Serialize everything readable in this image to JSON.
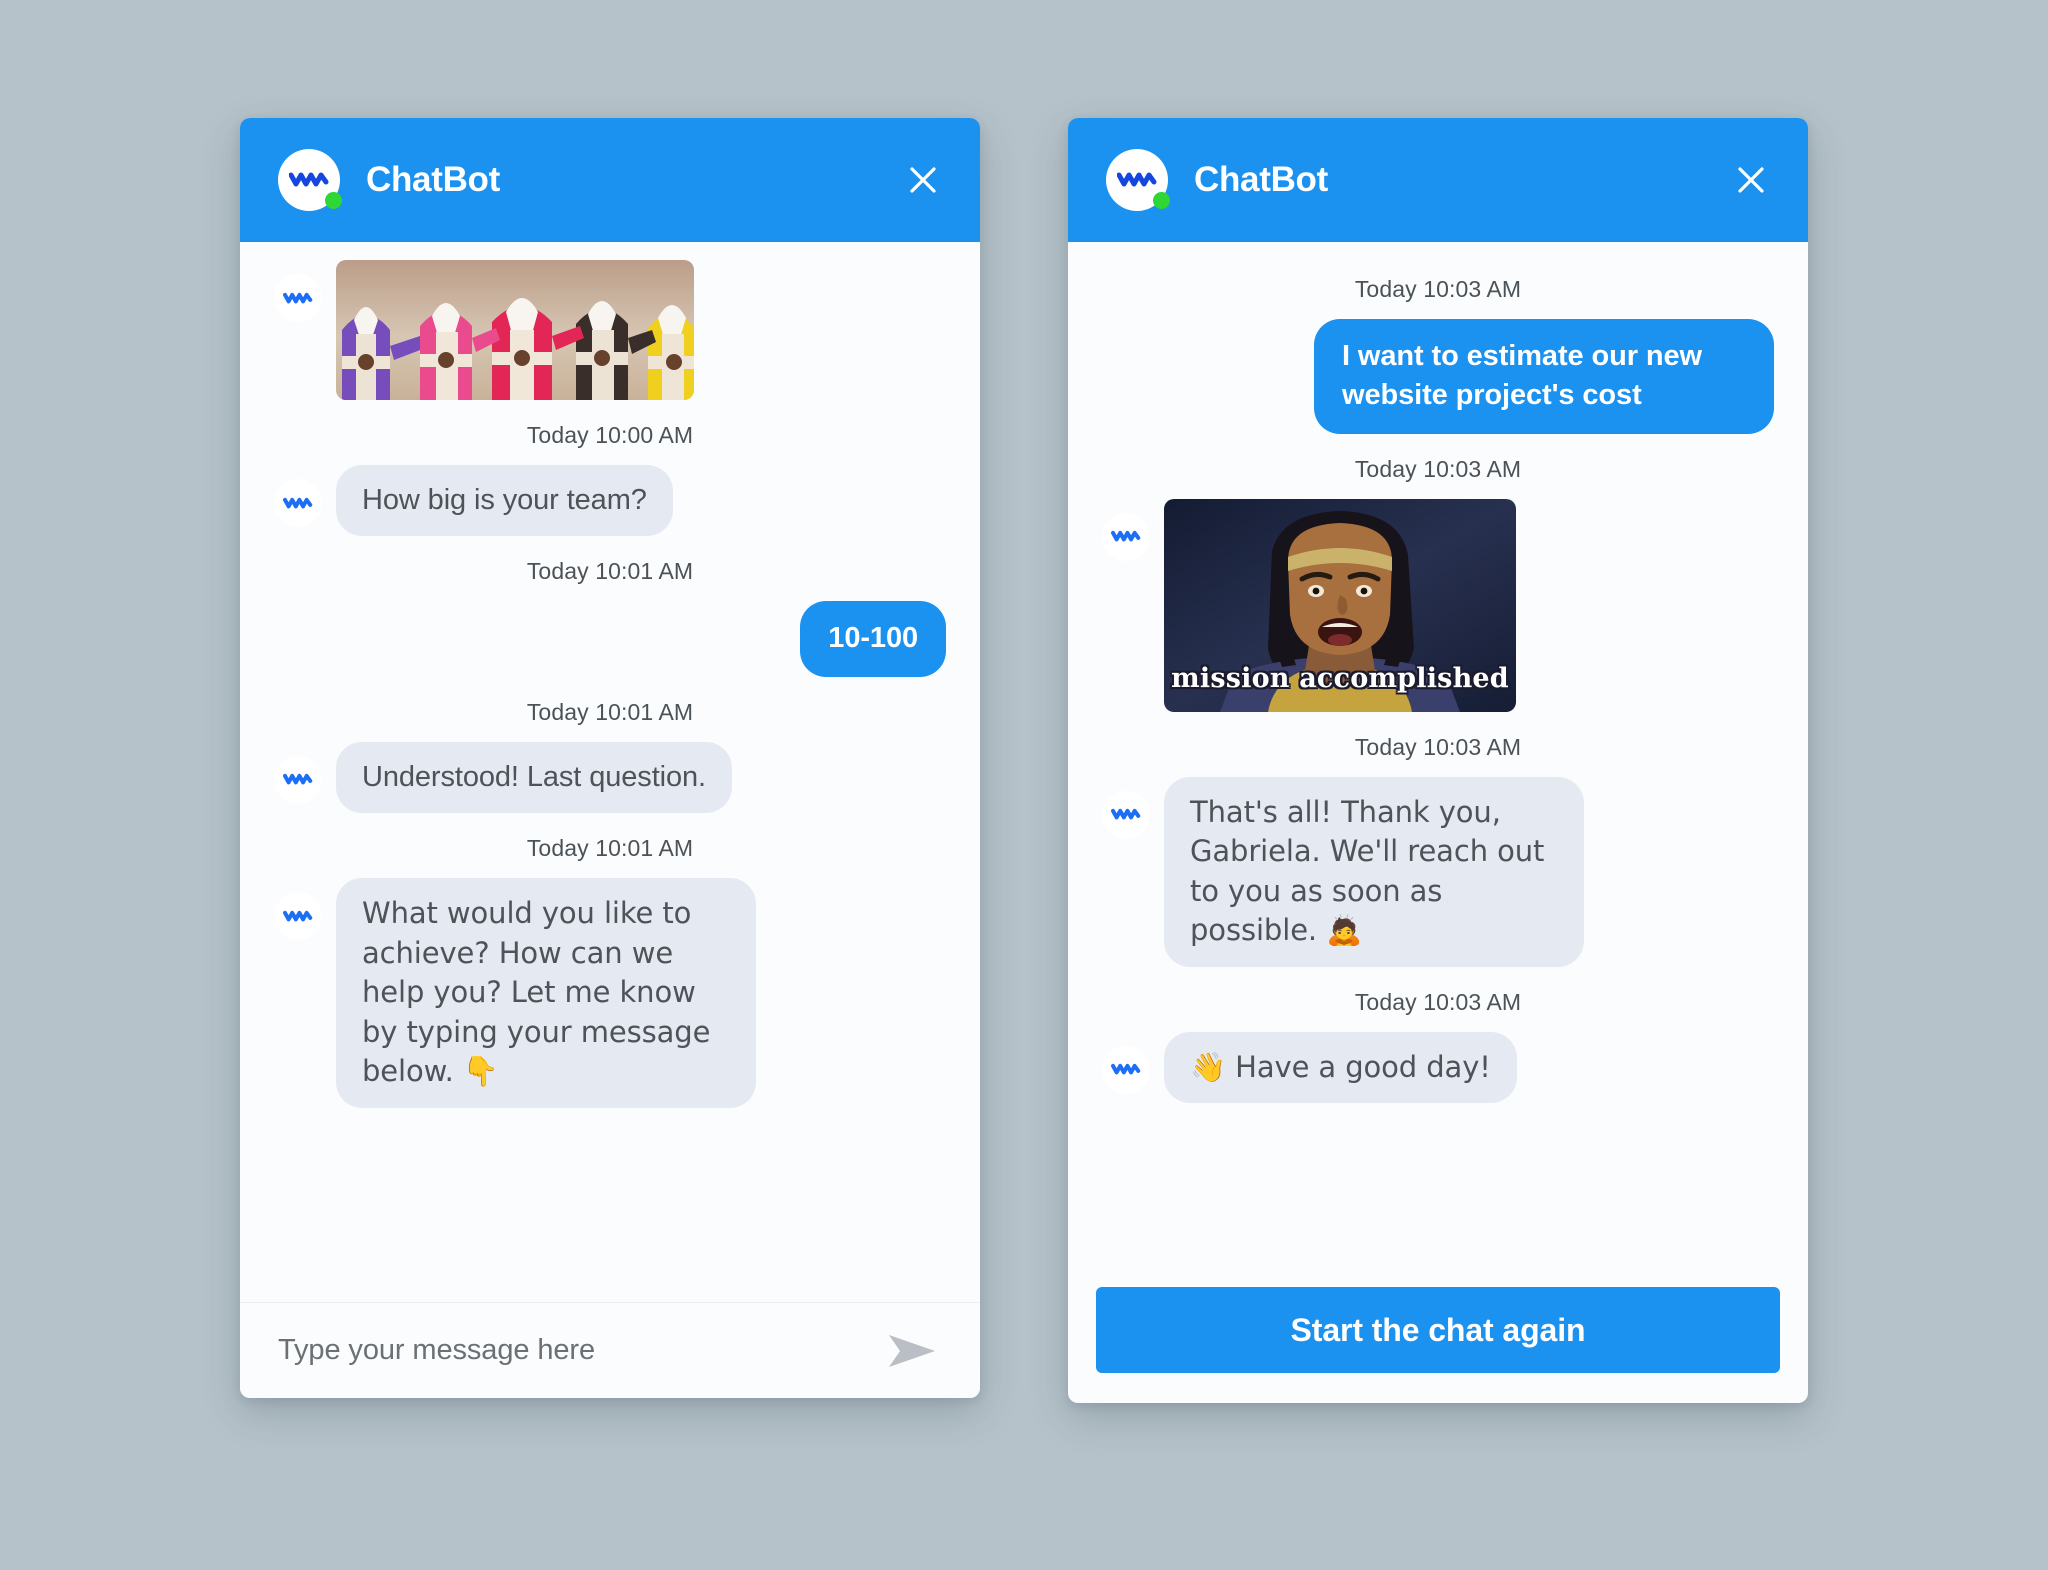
{
  "brand": {
    "accent_color": "#1b91f0",
    "bot_bubble_color": "#e5e9f2",
    "bot_text_color": "#4d5458",
    "status_color": "#2ed636",
    "page_background": "#b5c2c9",
    "panel_background": "#fbfcfd"
  },
  "left_panel": {
    "header": {
      "title": "ChatBot",
      "close_label": "×",
      "status": "online"
    },
    "messages": [
      {
        "from": "bot",
        "type": "image",
        "alt": "Power Rangers team fist bump",
        "caption": ""
      },
      {
        "from": "bot",
        "type": "text",
        "timestamp": "Today 10:00 AM",
        "text": "How big is your team?"
      },
      {
        "from": "user",
        "type": "text",
        "timestamp": "Today 10:01 AM",
        "text": "10-100"
      },
      {
        "from": "bot",
        "type": "text",
        "timestamp": "Today 10:01 AM",
        "text": "Understood! Last question."
      },
      {
        "from": "bot",
        "type": "text",
        "timestamp": "Today 10:01 AM",
        "text": "What would you like to achieve? How can we help you? Let me know by typing your message below. 👇"
      }
    ],
    "composer": {
      "placeholder": "Type your message here",
      "value": "",
      "send_label": "send-arrow"
    }
  },
  "right_panel": {
    "header": {
      "title": "ChatBot",
      "close_label": "×",
      "status": "online"
    },
    "messages": [
      {
        "from": "user",
        "type": "text",
        "timestamp": "Today 10:03 AM",
        "text": "I want to estimate our new website project's cost"
      },
      {
        "from": "bot",
        "type": "image",
        "timestamp": "Today 10:03 AM",
        "alt": "Kronk from The Emperor's New Groove",
        "caption": "mission accomplished"
      },
      {
        "from": "bot",
        "type": "text",
        "timestamp": "Today 10:03 AM",
        "text": "That's all! Thank you, Gabriela. We'll reach out to you as soon as possible. 🙇"
      },
      {
        "from": "bot",
        "type": "text",
        "timestamp": "Today 10:03 AM",
        "text": "👋 Have a good day!"
      }
    ],
    "restart_button": "Start the chat again"
  }
}
